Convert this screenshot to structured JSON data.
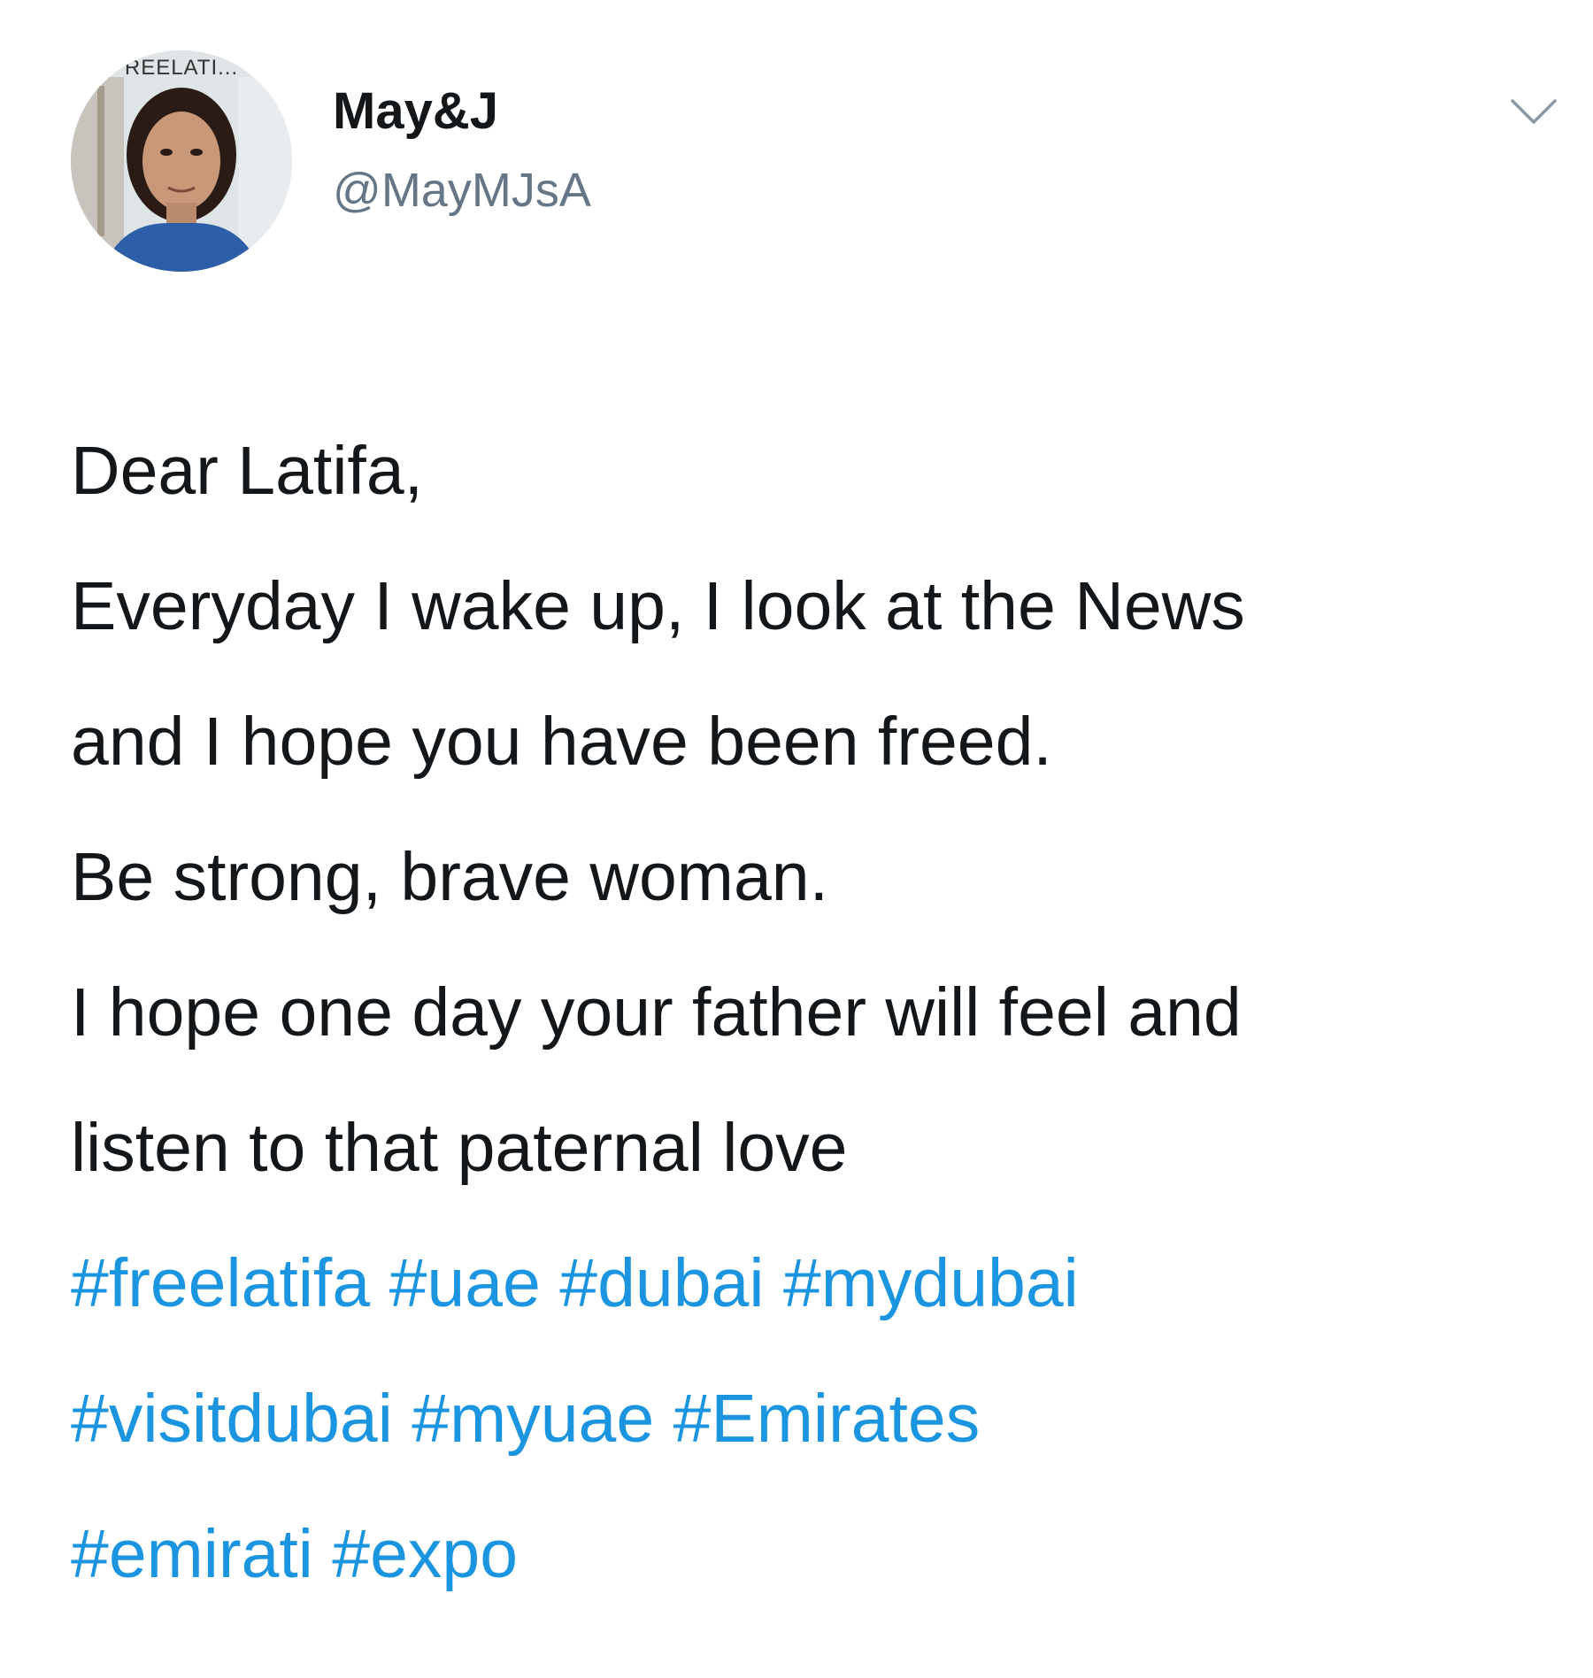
{
  "user": {
    "display_name": "May&J",
    "handle": "@MayMJsA",
    "avatar_caption": "REELATI..."
  },
  "menu": {
    "icon": "chevron-down-icon"
  },
  "tweet": {
    "lines": [
      "Dear Latifa,",
      "Everyday I wake up, I look at the News",
      "and I hope you have been freed.",
      "Be strong, brave woman.",
      "I hope one day your father will feel and",
      "listen to that paternal love"
    ],
    "hashtags": [
      "#freelatifa",
      "#uae",
      "#dubai",
      "#mydubai",
      "#visitdubai",
      "#myuae",
      "#Emirates",
      "#emirati",
      "#expo"
    ]
  },
  "colors": {
    "text": "#14171a",
    "secondary": "#657786",
    "link": "#1b95e0"
  }
}
